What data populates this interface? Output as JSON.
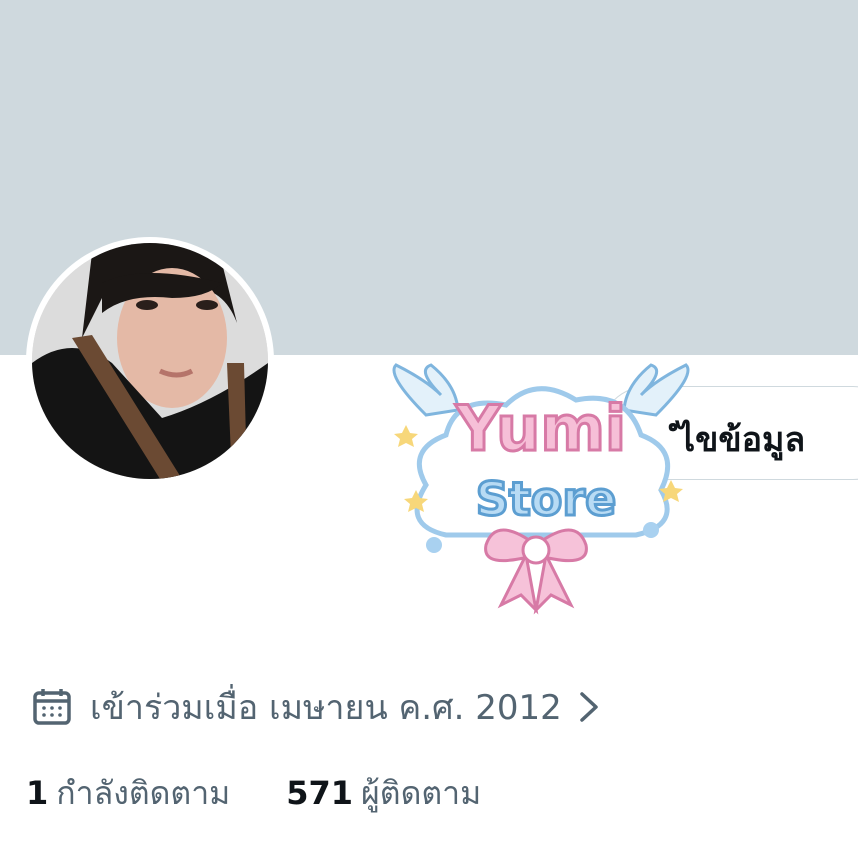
{
  "profile": {
    "banner_color": "#cfd9de",
    "edit_profile_label": "ํไขข้อมูล",
    "sticker_text_1": "Yumi",
    "sticker_text_2": "Store",
    "joined_text": "เข้าร่วมเมื่อ เมษายน ค.ศ. 2012",
    "following_count": "1",
    "following_label": "กำลังติดตาม",
    "followers_count": "571",
    "followers_label": "ผู้ติดตาม"
  }
}
